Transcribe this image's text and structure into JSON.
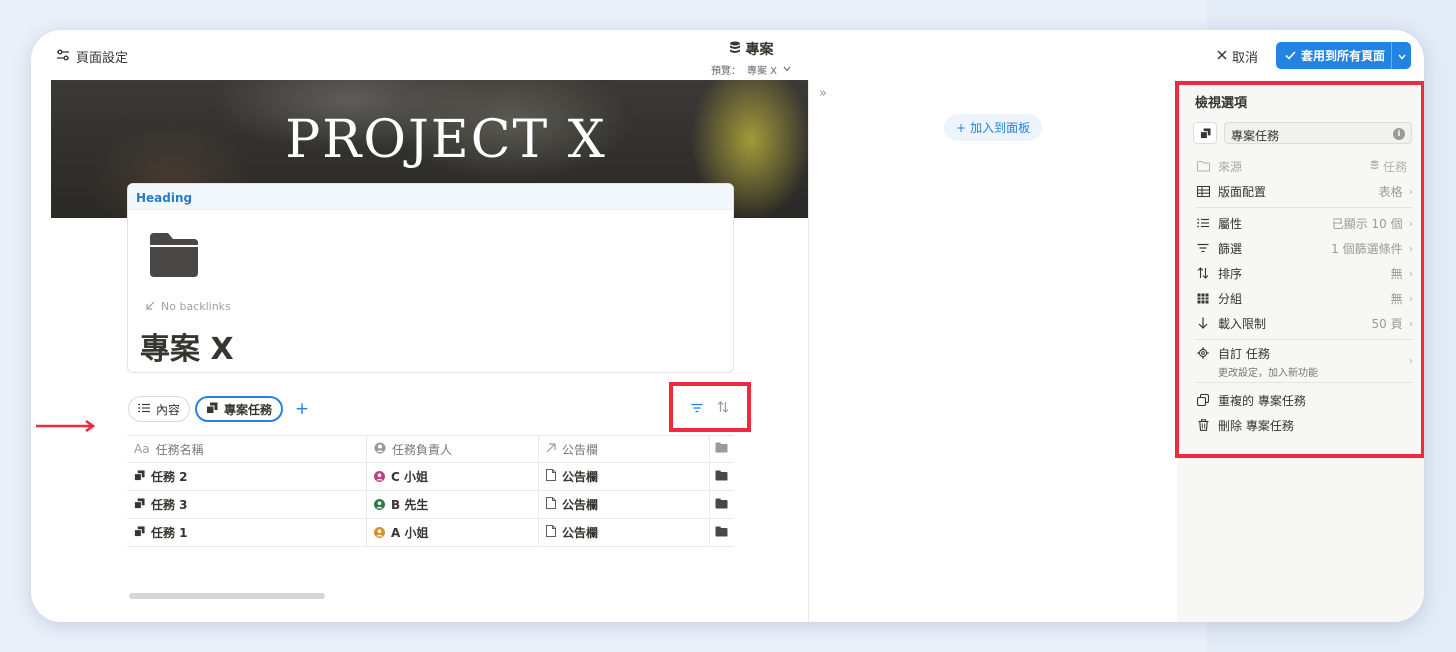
{
  "toolbar": {
    "page_settings_label": "頁面設定",
    "db_title": "專案",
    "preview_label": "預覽：",
    "preview_value": "專案 X",
    "cancel_label": "取消",
    "apply_label": "套用到所有頁面"
  },
  "page": {
    "cover_title": "PROJECT X",
    "heading_label": "Heading",
    "backlinks_label": "No backlinks",
    "title": "專案 X",
    "tabs": [
      {
        "label": "內容",
        "icon": "list-icon",
        "active": false
      },
      {
        "label": "專案任務",
        "icon": "database-page-icon",
        "active": true
      }
    ]
  },
  "table": {
    "columns": [
      {
        "prefix": "Aa",
        "label": "任務名稱"
      },
      {
        "icon": "person-icon",
        "label": "任務負責人"
      },
      {
        "icon": "arrow-up-right-icon",
        "label": "公告欄"
      },
      {
        "icon": "folder-icon",
        "label": ""
      }
    ],
    "rows": [
      {
        "name": "任務 2",
        "assignee": "C 小姐",
        "avatar_color": "#c0407f",
        "board": "公告欄"
      },
      {
        "name": "任務 3",
        "assignee": "B 先生",
        "avatar_color": "#2f7a4b",
        "board": "公告欄"
      },
      {
        "name": "任務 1",
        "assignee": "A 小姐",
        "avatar_color": "#d6912a",
        "board": "公告欄"
      }
    ]
  },
  "board": {
    "add_label": "加入到面板"
  },
  "view_options": {
    "title": "檢視選項",
    "view_name": "專案任務",
    "source": {
      "label": "來源",
      "value": "任務"
    },
    "layout": {
      "label": "版面配置",
      "value": "表格"
    },
    "properties": {
      "label": "屬性",
      "value": "已顯示 10 個"
    },
    "filter": {
      "label": "篩選",
      "value": "1 個篩選條件"
    },
    "sort": {
      "label": "排序",
      "value": "無"
    },
    "group": {
      "label": "分組",
      "value": "無"
    },
    "load_limit": {
      "label": "載入限制",
      "value": "50 頁"
    },
    "customize": {
      "label": "自訂 任務",
      "sub": "更改設定，加入新功能"
    },
    "duplicate_label": "重複的 專案任務",
    "delete_label": "刪除 專案任務"
  },
  "colors": {
    "accent": "#2383e2",
    "highlight": "#ee2b3e"
  }
}
